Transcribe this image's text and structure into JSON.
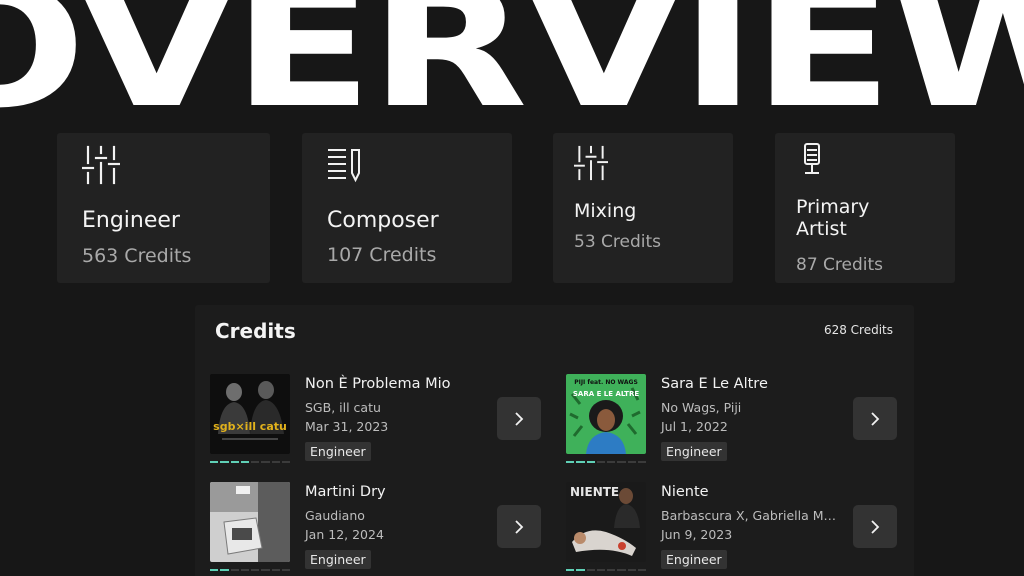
{
  "hero": {
    "title": "OVERVIEW"
  },
  "roles": [
    {
      "name": "Engineer",
      "count": "563 Credits",
      "icon": "sliders-icon"
    },
    {
      "name": "Composer",
      "count": "107 Credits",
      "icon": "sheet-pen-icon"
    },
    {
      "name": "Mixing",
      "count": "53 Credits",
      "icon": "sliders-icon"
    },
    {
      "name": "Primary Artist",
      "count": "87 Credits",
      "icon": "microphone-icon"
    }
  ],
  "credits": {
    "title": "Credits",
    "count": "628 Credits",
    "items": [
      {
        "title": "Non È Problema Mio",
        "artists": "SGB, ill catu",
        "date": "Mar 31, 2023",
        "role": "Engineer",
        "progress": 0.5
      },
      {
        "title": "Sara E Le Altre",
        "artists": "No Wags, Piji",
        "date": "Jul 1, 2022",
        "role": "Engineer",
        "progress": 0.38
      },
      {
        "title": "Martini Dry",
        "artists": "Gaudiano",
        "date": "Jan 12, 2024",
        "role": "Engineer",
        "progress": 0.25
      },
      {
        "title": "Niente",
        "artists": "Barbascura X, Gabriella Ma...",
        "date": "Jun 9, 2023",
        "role": "Engineer",
        "progress": 0.25
      }
    ]
  },
  "colors": {
    "background": "#171717",
    "card": "#222222",
    "accent": "#5fd0b6",
    "badge": "#333333"
  }
}
